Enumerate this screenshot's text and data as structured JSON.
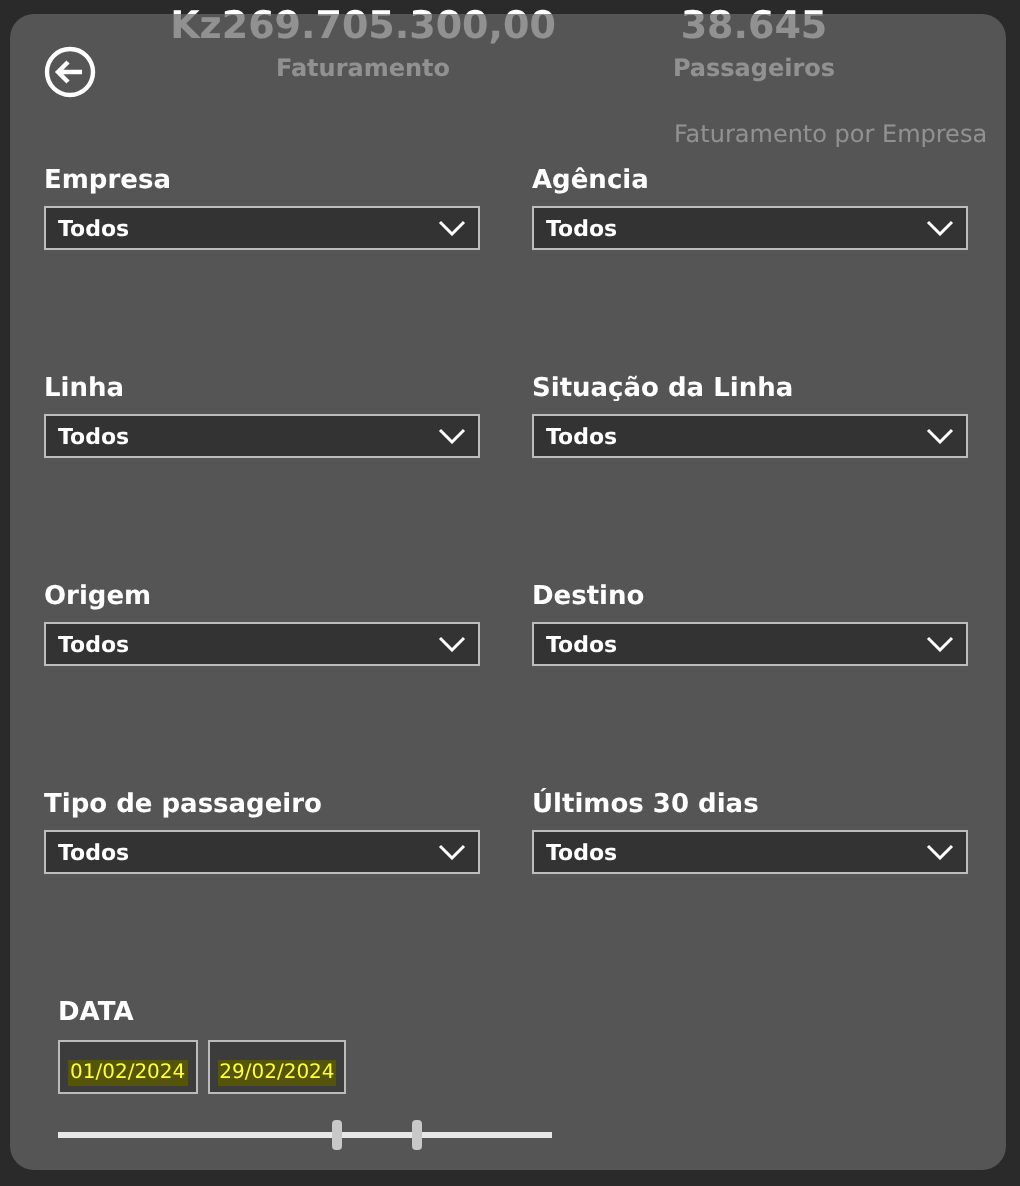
{
  "dashboard": {
    "cards": [
      {
        "value": "Kz269.705.300,00",
        "label": "Faturamento"
      },
      {
        "value": "38.645",
        "label": "Passageiros"
      }
    ],
    "chart_title": "Faturamento por Empresa"
  },
  "filters": [
    {
      "label": "Empresa",
      "value": "Todos"
    },
    {
      "label": "Agência",
      "value": "Todos"
    },
    {
      "label": "Linha",
      "value": "Todos"
    },
    {
      "label": "Situação da Linha",
      "value": "Todos"
    },
    {
      "label": "Origem",
      "value": "Todos"
    },
    {
      "label": "Destino",
      "value": "Todos"
    },
    {
      "label": "Tipo de passageiro",
      "value": "Todos"
    },
    {
      "label": "Últimos 30 dias",
      "value": "Todos"
    }
  ],
  "date": {
    "label": "DATA",
    "start": "01/02/2024",
    "end": "29/02/2024",
    "thumbs": [
      {
        "level": 0.565
      },
      {
        "level": 0.73
      }
    ]
  }
}
